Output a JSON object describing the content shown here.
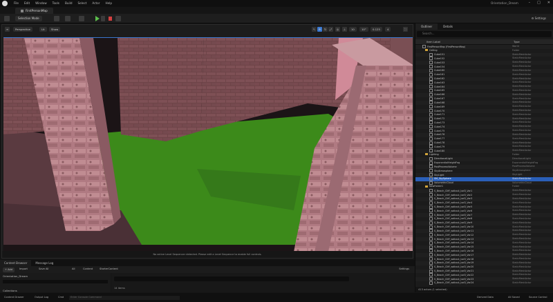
{
  "app": {
    "project": "Orientation_Dream",
    "map_tab": "FirstPersonMap"
  },
  "menu": [
    "File",
    "Edit",
    "Window",
    "Tools",
    "Build",
    "Select",
    "Actor",
    "Help"
  ],
  "toolbar": {
    "mode": "Selection Mode",
    "settings": "Settings"
  },
  "viewport": {
    "perspective": "Perspective",
    "lit": "Lit",
    "show": "Show",
    "grid_snap": "10",
    "angle_snap": "10°",
    "scale_snap": "0.125",
    "camera_speed": "4",
    "message": "No active Level Sequencer detected. Please edit a Level Sequence to enable full controls."
  },
  "colors": {
    "accent": "#3a78d0",
    "selection": "#2a5fb8",
    "floor": "#3c8a1a",
    "walls": "#b07a82",
    "play": "#5cbf4c",
    "stop": "#d54040"
  },
  "outliner": {
    "tabs": [
      "Outliner",
      "Details"
    ],
    "search_placeholder": "Search...",
    "col_label": "Item Label",
    "col_type": "Type",
    "rows": [
      {
        "name": "FirstPersonMap (FirstPersonMap)",
        "type": "World",
        "kind": "actor"
      },
      {
        "name": "Ceiling",
        "type": "Folder",
        "kind": "folder"
      },
      {
        "name": "Cube151",
        "type": "StaticMeshActor",
        "kind": "actor"
      },
      {
        "name": "Cube152",
        "type": "StaticMeshActor",
        "kind": "actor"
      },
      {
        "name": "Cube153",
        "type": "StaticMeshActor",
        "kind": "actor"
      },
      {
        "name": "Cube154",
        "type": "StaticMeshActor",
        "kind": "actor"
      },
      {
        "name": "Cube160",
        "type": "StaticMeshActor",
        "kind": "actor"
      },
      {
        "name": "Cube161",
        "type": "StaticMeshActor",
        "kind": "actor"
      },
      {
        "name": "Cube162",
        "type": "StaticMeshActor",
        "kind": "actor"
      },
      {
        "name": "Cube163",
        "type": "StaticMeshActor",
        "kind": "actor"
      },
      {
        "name": "Cube164",
        "type": "StaticMeshActor",
        "kind": "actor"
      },
      {
        "name": "Cube165",
        "type": "StaticMeshActor",
        "kind": "actor"
      },
      {
        "name": "Cube166",
        "type": "StaticMeshActor",
        "kind": "actor"
      },
      {
        "name": "Cube167",
        "type": "StaticMeshActor",
        "kind": "actor"
      },
      {
        "name": "Cube168",
        "type": "StaticMeshActor",
        "kind": "actor"
      },
      {
        "name": "Cube169",
        "type": "StaticMeshActor",
        "kind": "actor"
      },
      {
        "name": "Cube170",
        "type": "StaticMeshActor",
        "kind": "actor"
      },
      {
        "name": "Cube171",
        "type": "StaticMeshActor",
        "kind": "actor"
      },
      {
        "name": "Cube172",
        "type": "StaticMeshActor",
        "kind": "actor"
      },
      {
        "name": "Cube173",
        "type": "StaticMeshActor",
        "kind": "actor"
      },
      {
        "name": "Cube174",
        "type": "StaticMeshActor",
        "kind": "actor"
      },
      {
        "name": "Cube175",
        "type": "StaticMeshActor",
        "kind": "actor"
      },
      {
        "name": "Cube176",
        "type": "StaticMeshActor",
        "kind": "actor"
      },
      {
        "name": "Cube177",
        "type": "StaticMeshActor",
        "kind": "actor"
      },
      {
        "name": "Cube178",
        "type": "StaticMeshActor",
        "kind": "actor"
      },
      {
        "name": "Cube179",
        "type": "StaticMeshActor",
        "kind": "actor"
      },
      {
        "name": "Cube180",
        "type": "StaticMeshActor",
        "kind": "actor"
      },
      {
        "name": "Lighting",
        "type": "Folder",
        "kind": "folder"
      },
      {
        "name": "DirectionalLight",
        "type": "DirectionalLight",
        "kind": "actor"
      },
      {
        "name": "ExponentialHeightFog",
        "type": "ExponentialHeightFog",
        "kind": "actor"
      },
      {
        "name": "PostProcessVolume",
        "type": "PostProcessVolume",
        "kind": "actor"
      },
      {
        "name": "SkyAtmosphere",
        "type": "SkyAtmosphere",
        "kind": "actor"
      },
      {
        "name": "SkyLight",
        "type": "SkyLight",
        "kind": "actor"
      },
      {
        "name": "SM_SkySphere",
        "type": "StaticMeshActor",
        "kind": "actor",
        "selected": true
      },
      {
        "name": "VolumetricCloud",
        "type": "VolumetricCloud",
        "kind": "actor"
      },
      {
        "name": "NewFolder1",
        "type": "Folder",
        "kind": "folder"
      },
      {
        "name": "S_Beach_Cliff_wdkxut_lod3_Var1",
        "type": "StaticMeshActor",
        "kind": "actor"
      },
      {
        "name": "S_Beach_Cliff_wdkxut_lod3_Var2",
        "type": "StaticMeshActor",
        "kind": "actor"
      },
      {
        "name": "S_Beach_Cliff_wdkxut_lod3_Var3",
        "type": "StaticMeshActor",
        "kind": "actor"
      },
      {
        "name": "S_Beach_Cliff_wdkxut_lod3_Var4",
        "type": "StaticMeshActor",
        "kind": "actor"
      },
      {
        "name": "S_Beach_Cliff_wdkxut_lod3_Var5",
        "type": "StaticMeshActor",
        "kind": "actor"
      },
      {
        "name": "S_Beach_Cliff_wdkxut_lod3_Var6",
        "type": "StaticMeshActor",
        "kind": "actor"
      },
      {
        "name": "S_Beach_Cliff_wdkxut_lod3_Var7",
        "type": "StaticMeshActor",
        "kind": "actor"
      },
      {
        "name": "S_Beach_Cliff_wdkxut_lod3_Var8",
        "type": "StaticMeshActor",
        "kind": "actor"
      },
      {
        "name": "S_Beach_Cliff_wdkxut_lod3_Var9",
        "type": "StaticMeshActor",
        "kind": "actor"
      },
      {
        "name": "S_Beach_Cliff_wdkxut_lod3_Var10",
        "type": "StaticMeshActor",
        "kind": "actor"
      },
      {
        "name": "S_Beach_Cliff_wdkxut_lod3_Var11",
        "type": "StaticMeshActor",
        "kind": "actor"
      },
      {
        "name": "S_Beach_Cliff_wdkxut_lod3_Var12",
        "type": "StaticMeshActor",
        "kind": "actor"
      },
      {
        "name": "S_Beach_Cliff_wdkxut_lod3_Var13",
        "type": "StaticMeshActor",
        "kind": "actor"
      },
      {
        "name": "S_Beach_Cliff_wdkxut_lod3_Var14",
        "type": "StaticMeshActor",
        "kind": "actor"
      },
      {
        "name": "S_Beach_Cliff_wdkxut_lod3_Var15",
        "type": "StaticMeshActor",
        "kind": "actor"
      },
      {
        "name": "S_Beach_Cliff_wdkxut_lod3_Var16",
        "type": "StaticMeshActor",
        "kind": "actor"
      },
      {
        "name": "S_Beach_Cliff_wdkxut_lod3_Var17",
        "type": "StaticMeshActor",
        "kind": "actor"
      },
      {
        "name": "S_Beach_Cliff_wdkxut_lod3_Var18",
        "type": "StaticMeshActor",
        "kind": "actor"
      },
      {
        "name": "S_Beach_Cliff_wdkxut_lod3_Var19",
        "type": "StaticMeshActor",
        "kind": "actor"
      },
      {
        "name": "S_Beach_Cliff_wdkxut_lod3_Var20",
        "type": "StaticMeshActor",
        "kind": "actor"
      },
      {
        "name": "S_Beach_Cliff_wdkxut_lod3_Var21",
        "type": "StaticMeshActor",
        "kind": "actor"
      },
      {
        "name": "S_Beach_Cliff_wdkxut_lod3_Var22",
        "type": "StaticMeshActor",
        "kind": "actor"
      },
      {
        "name": "S_Beach_Cliff_wdkxut_lod3_Var23",
        "type": "StaticMeshActor",
        "kind": "actor"
      },
      {
        "name": "S_Beach_Cliff_wdkxut_lod3_Var24",
        "type": "StaticMeshActor",
        "kind": "actor"
      }
    ],
    "count": "413 actors (1 selected)"
  },
  "bottom": {
    "tabs": [
      "Content Browser",
      "Message Log"
    ],
    "add": "+ Add",
    "import": "Import",
    "save_all": "Save All",
    "path": [
      "All",
      "Content",
      "StarterContent"
    ],
    "settings": "Settings",
    "tree_root": "Orientation_Dream",
    "collections": "Collections",
    "items": "14 items"
  },
  "status": {
    "content_drawer": "Content Drawer",
    "output_log": "Output Log",
    "cmd": "Cmd",
    "console_placeholder": "Enter Console Command",
    "derived_data": "Derived Data",
    "all_saved": "All Saved",
    "source_control": "Source Control"
  }
}
